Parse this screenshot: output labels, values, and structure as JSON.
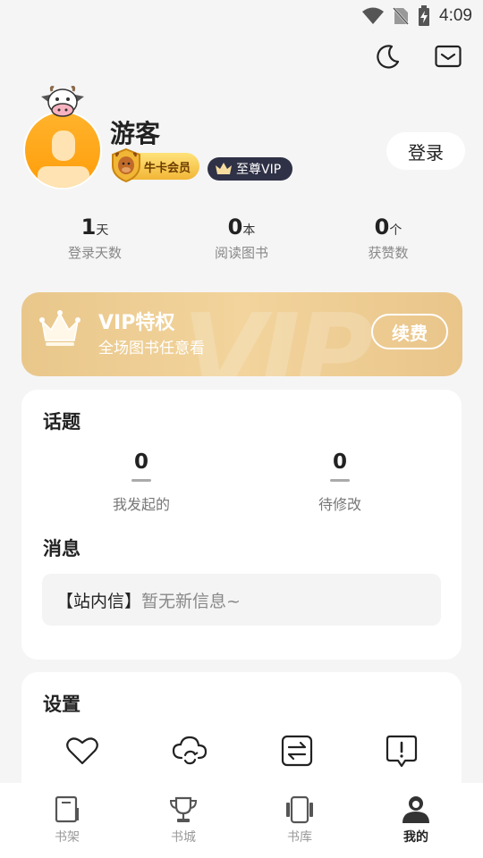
{
  "status": {
    "time": "4:09"
  },
  "profile": {
    "name": "游客",
    "badge_niuka": "牛卡会员",
    "badge_vip": "至尊VIP",
    "login_label": "登录"
  },
  "stats": [
    {
      "value": "1",
      "unit": "天",
      "label": "登录天数"
    },
    {
      "value": "0",
      "unit": "本",
      "label": "阅读图书"
    },
    {
      "value": "0",
      "unit": "个",
      "label": "获赞数"
    }
  ],
  "vip": {
    "title": "VIP特权",
    "subtitle": "全场图书任意看",
    "watermark": "VIP",
    "renew_label": "续费"
  },
  "topics": {
    "title": "话题",
    "items": [
      {
        "value": "0",
        "label": "我发起的"
      },
      {
        "value": "0",
        "label": "待修改"
      }
    ]
  },
  "messages": {
    "title": "消息",
    "tag": "【站内信】",
    "text": "暂无新信息~"
  },
  "settings": {
    "title": "设置",
    "icons": [
      "heart-icon",
      "cloud-sync-icon",
      "swap-icon",
      "feedback-icon"
    ]
  },
  "nav": [
    {
      "label": "书架",
      "icon": "bookshelf-icon",
      "active": false
    },
    {
      "label": "书城",
      "icon": "trophy-icon",
      "active": false
    },
    {
      "label": "书库",
      "icon": "library-icon",
      "active": false
    },
    {
      "label": "我的",
      "icon": "profile-icon",
      "active": true
    }
  ],
  "colors": {
    "vip_gold": "#e9c78b",
    "badge_dark": "#2f3146",
    "avatar_orange": "#ff9d0a"
  }
}
